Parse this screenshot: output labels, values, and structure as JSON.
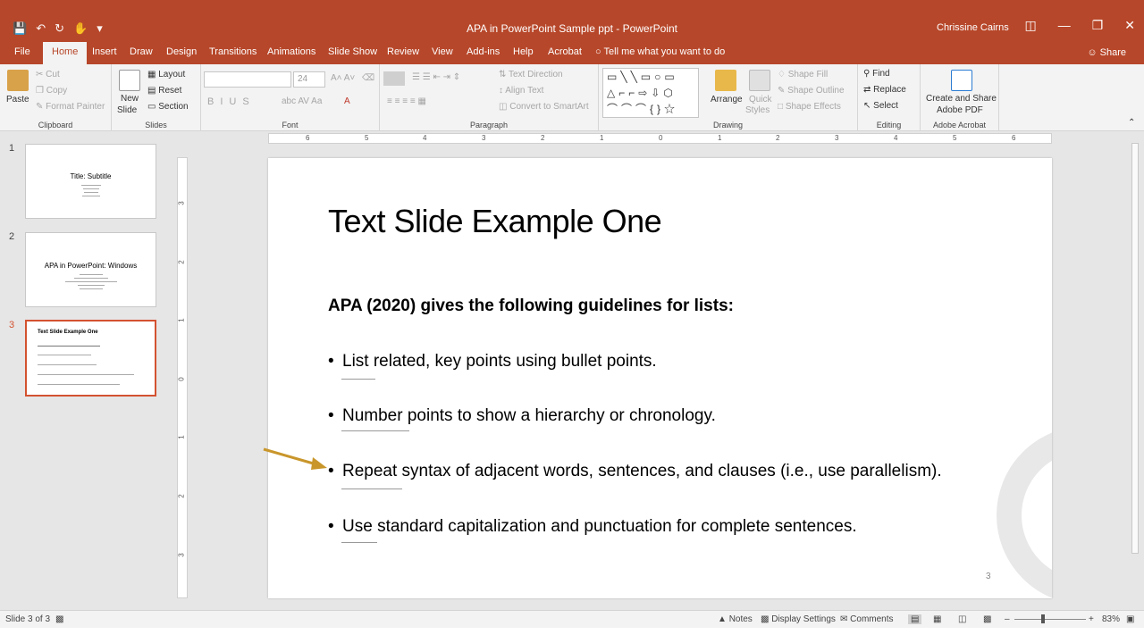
{
  "window": {
    "title": "APA in PowerPoint Sample ppt  -  PowerPoint",
    "user": "Chrissine Cairns",
    "qat_icons": [
      "save-icon",
      "undo-icon",
      "redo-icon",
      "touch-mode-icon",
      "customize-icon"
    ]
  },
  "tabs": [
    "File",
    "Home",
    "Insert",
    "Draw",
    "Design",
    "Transitions",
    "Animations",
    "Slide Show",
    "Review",
    "View",
    "Add-ins",
    "Help",
    "Acrobat"
  ],
  "active_tab": "Home",
  "tell_me": "Tell me what you want to do",
  "share": "Share",
  "ribbon": {
    "clipboard": {
      "paste": "Paste",
      "cut": "Cut",
      "copy": "Copy",
      "format_painter": "Format Painter",
      "label": "Clipboard"
    },
    "slides": {
      "new_slide": "New",
      "new_slide2": "Slide",
      "layout": "Layout",
      "reset": "Reset",
      "section": "Section",
      "label": "Slides"
    },
    "font": {
      "size": "24",
      "label": "Font"
    },
    "paragraph": {
      "text_direction": "Text Direction",
      "align_text": "Align Text",
      "convert": "Convert to SmartArt",
      "label": "Paragraph"
    },
    "drawing": {
      "arrange": "Arrange",
      "quick": "Quick",
      "styles": "Styles",
      "shape_fill": "Shape Fill",
      "shape_outline": "Shape Outline",
      "shape_effects": "Shape Effects",
      "label": "Drawing"
    },
    "editing": {
      "find": "Find",
      "replace": "Replace",
      "select": "Select",
      "label": "Editing"
    },
    "acrobat": {
      "create1": "Create and Share",
      "create2": "Adobe PDF",
      "label": "Adobe Acrobat"
    }
  },
  "thumbnails": [
    {
      "num": "1",
      "title": "Title: Subtitle"
    },
    {
      "num": "2",
      "title": "APA in PowerPoint: Windows"
    },
    {
      "num": "3",
      "title": "Text Slide Example One"
    }
  ],
  "ruler": {
    "h": [
      "6",
      "5",
      "4",
      "3",
      "2",
      "1",
      "0",
      "1",
      "2",
      "3",
      "4",
      "5",
      "6"
    ],
    "v": [
      "3",
      "2",
      "1",
      "0",
      "1",
      "2",
      "3"
    ]
  },
  "slide": {
    "title": "Text Slide Example One",
    "intro": "APA (2020) gives the following guidelines for lists:",
    "bullets": [
      "List related, key points using bullet points.",
      "Number points to show a hierarchy or chronology.",
      "Repeat syntax of adjacent words, sentences, and clauses (i.e., use parallelism).",
      "Use standard capitalization and punctuation for complete sentences."
    ],
    "bullet_char": "•",
    "page_number": "3"
  },
  "colors": {
    "accent": "#b7472a",
    "arrow": "#c9962b"
  },
  "status": {
    "slide_of": "Slide 3 of 3",
    "notes": "Notes",
    "display_settings": "Display Settings",
    "comments": "Comments",
    "zoom": "83%"
  }
}
